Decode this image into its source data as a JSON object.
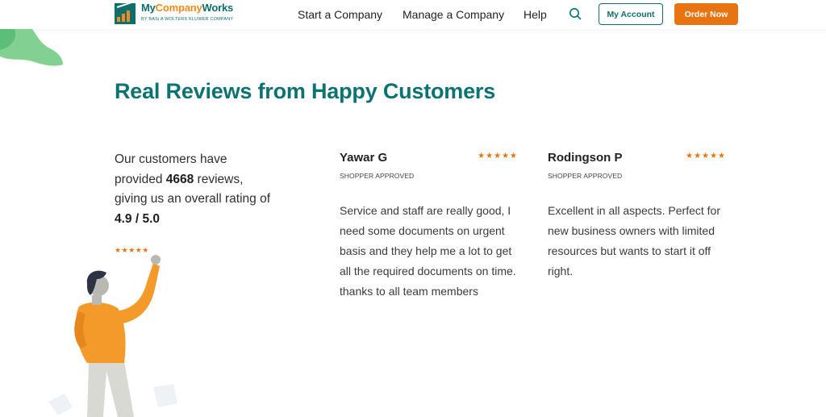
{
  "header": {
    "logo": {
      "name_my": "My",
      "name_company": "Company",
      "name_works": "Works",
      "tagline": "BY BASi A WOLTERS KLUWER COMPANY"
    },
    "nav": {
      "start": "Start a Company",
      "manage": "Manage a Company",
      "help": "Help"
    },
    "search_icon": "search-icon",
    "my_account_label": "My Account",
    "order_now_label": "Order Now"
  },
  "colors": {
    "brand_teal": "#0d7272",
    "accent_orange": "#e87411",
    "blob_green": "#6fcf8f"
  },
  "section": {
    "heading": "Real Reviews from Happy Customers"
  },
  "summary": {
    "text_before": "Our customers have provided ",
    "count": "4668",
    "text_middle": " reviews, giving us an overall rating of ",
    "rating": "4.9 / 5.0",
    "stars": "★★★★★",
    "rating_value": 4.9,
    "rating_max": 5
  },
  "reviews": [
    {
      "name": "Yawar G",
      "stars": "★★★★★",
      "badge": "SHOPPER APPROVED",
      "text": "Service and staff are really good, I need some documents on urgent basis and they help me a lot to get all the required documents on time. thanks to all team members"
    },
    {
      "name": "Rodingson P",
      "stars": "★★★★★",
      "badge": "SHOPPER APPROVED",
      "text": "Excellent in all aspects. Perfect for new business owners with limited resources but wants to start it off right."
    }
  ]
}
